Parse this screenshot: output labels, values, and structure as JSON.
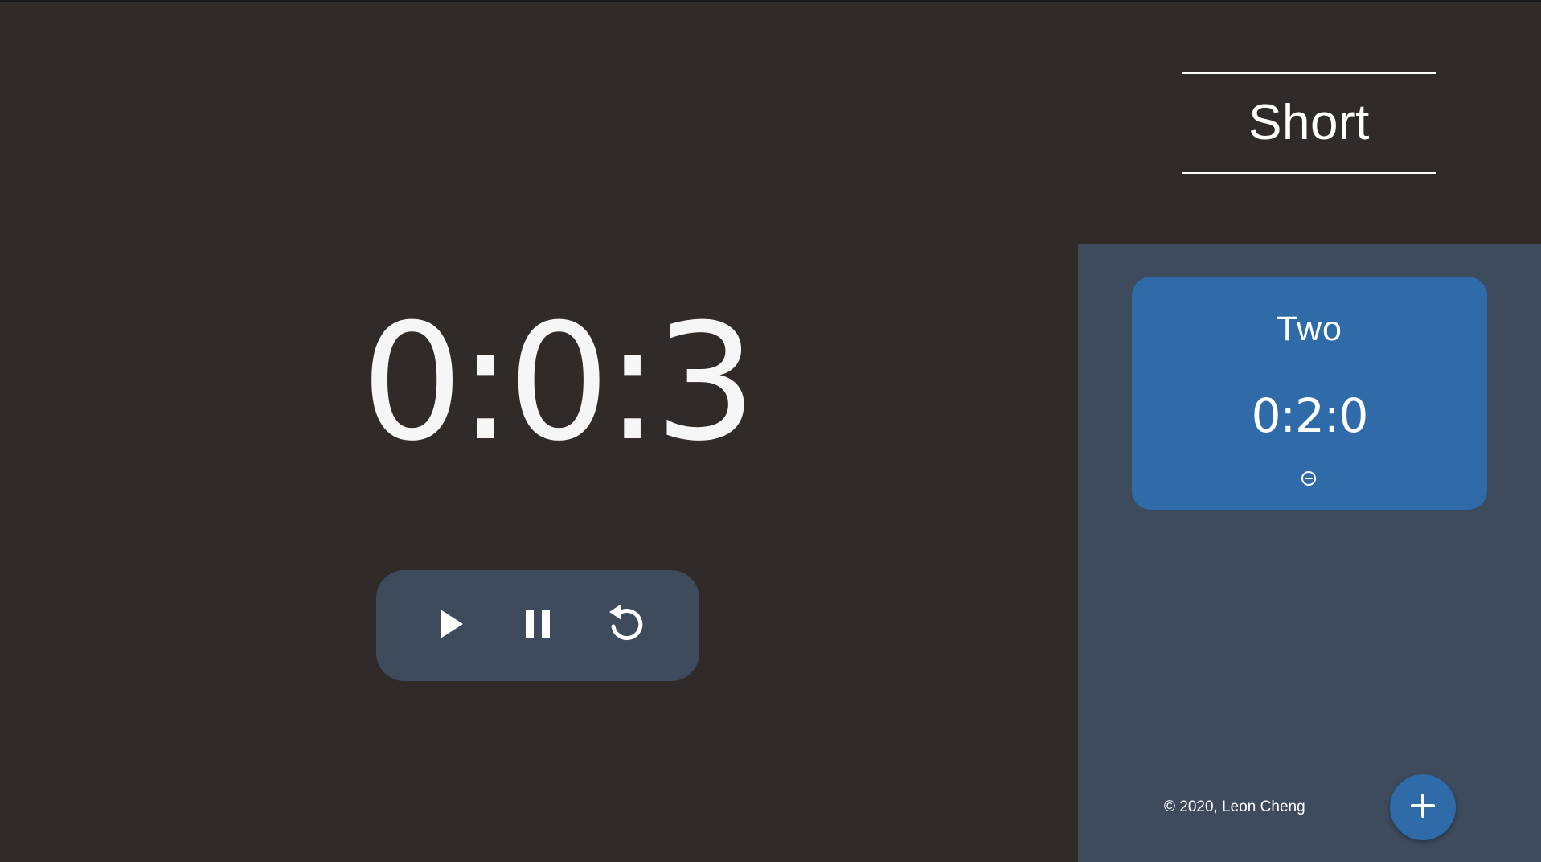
{
  "header": {
    "title": "Short"
  },
  "main": {
    "timer_display": "0:0:3"
  },
  "controls": {
    "play_icon": "play-icon",
    "pause_icon": "pause-icon",
    "restart_icon": "restart-icon"
  },
  "sidebar": {
    "timers": [
      {
        "name": "Two",
        "time": "0:2:0",
        "remove_icon": "remove-circle-icon"
      }
    ],
    "footer": {
      "copyright": "© 2020, Leon Cheng"
    },
    "add_icon": "plus-icon"
  },
  "colors": {
    "background": "#302b28",
    "panel": "#3d4b5d",
    "accent": "#2f6aa9",
    "text": "#ffffff"
  }
}
